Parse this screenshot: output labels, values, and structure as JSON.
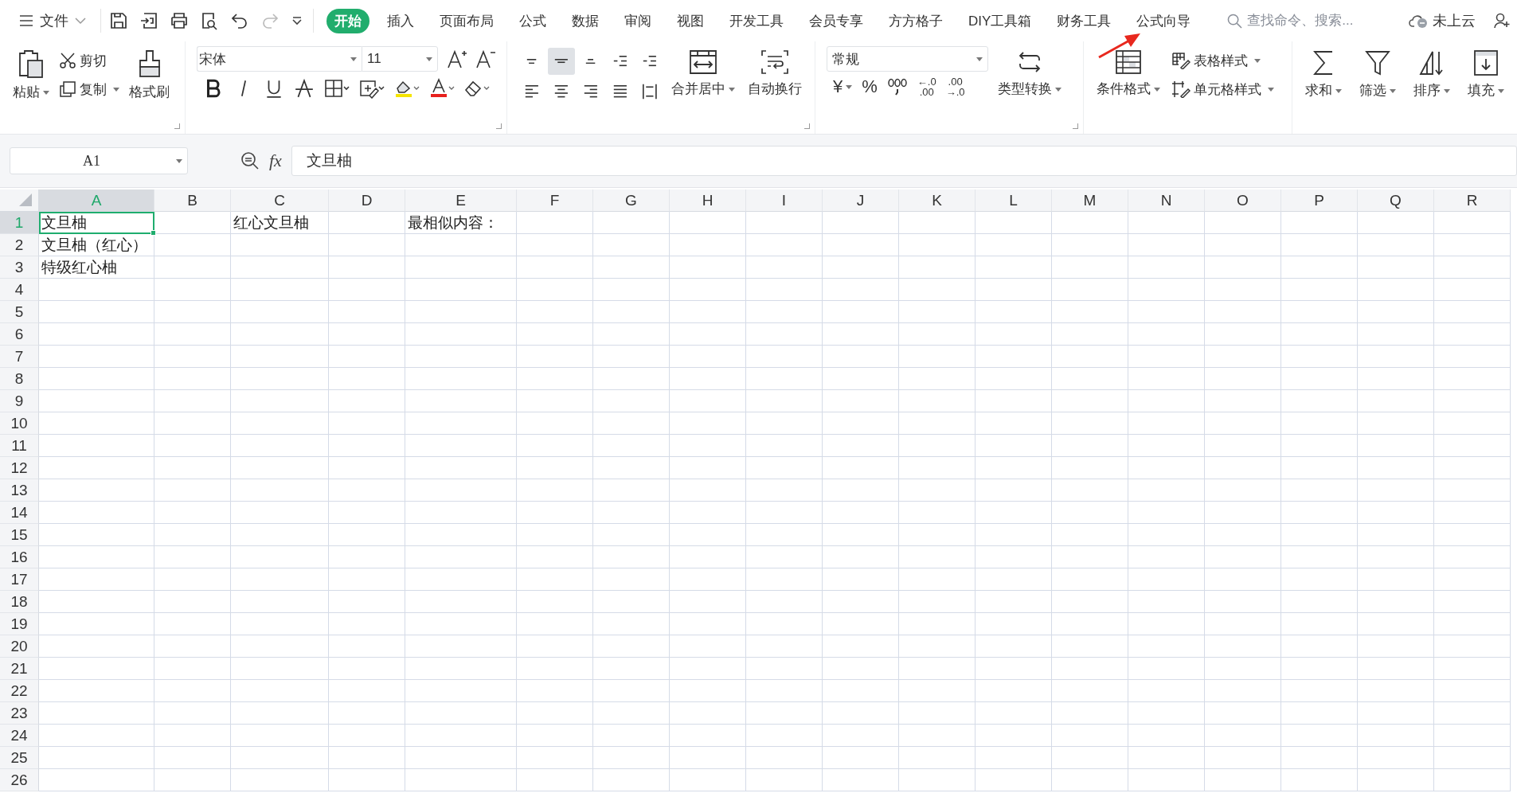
{
  "menu": {
    "file": "文件",
    "tabs": [
      {
        "label": "开始",
        "selected": true
      },
      {
        "label": "插入",
        "selected": false
      },
      {
        "label": "页面布局",
        "selected": false
      },
      {
        "label": "公式",
        "selected": false
      },
      {
        "label": "数据",
        "selected": false
      },
      {
        "label": "审阅",
        "selected": false
      },
      {
        "label": "视图",
        "selected": false
      },
      {
        "label": "开发工具",
        "selected": false
      },
      {
        "label": "会员专享",
        "selected": false
      },
      {
        "label": "方方格子",
        "selected": false
      },
      {
        "label": "DIY工具箱",
        "selected": false
      },
      {
        "label": "财务工具",
        "selected": false
      },
      {
        "label": "公式向导",
        "selected": false
      }
    ]
  },
  "search": {
    "placeholder": "查找命令、搜索..."
  },
  "cloud": {
    "label": "未上云"
  },
  "ribbon": {
    "clipboard": {
      "paste": "粘贴",
      "cut": "剪切",
      "copy": "复制",
      "format_painter": "格式刷"
    },
    "font": {
      "name": "宋体",
      "size": "11"
    },
    "alignment": {
      "buttons": [
        {
          "selected": false
        },
        {
          "selected": true
        },
        {
          "selected": false
        },
        {
          "selected": false
        },
        {
          "selected": false
        },
        {
          "selected": false
        },
        {
          "selected": false
        },
        {
          "selected": false
        },
        {
          "selected": false
        },
        {
          "selected": false
        }
      ],
      "merge": "合并居中",
      "wrap": "自动换行"
    },
    "number": {
      "format": "常规",
      "currency": "¥",
      "percent": "%",
      "decimals": [
        {
          "lines": [
            "←.0",
            ".00"
          ]
        },
        {
          "lines": [
            ".00",
            "→.0"
          ]
        }
      ],
      "convert": "类型转换"
    },
    "styles": {
      "conditional": "条件格式",
      "table_style": "表格样式",
      "cell_style": "单元格样式"
    },
    "editing": [
      {
        "label": "求和"
      },
      {
        "label": "筛选"
      },
      {
        "label": "排序"
      },
      {
        "label": "填充"
      }
    ]
  },
  "formula_bar": {
    "cell": "A1",
    "fx": "fx",
    "value": "文旦柚"
  },
  "sheet": {
    "columns": [
      {
        "label": "A",
        "selected": true
      },
      {
        "label": "B",
        "selected": false
      },
      {
        "label": "C",
        "selected": false
      },
      {
        "label": "D",
        "selected": false
      },
      {
        "label": "E",
        "selected": false
      },
      {
        "label": "F",
        "selected": false
      },
      {
        "label": "G",
        "selected": false
      },
      {
        "label": "H",
        "selected": false
      },
      {
        "label": "I",
        "selected": false
      },
      {
        "label": "J",
        "selected": false
      },
      {
        "label": "K",
        "selected": false
      },
      {
        "label": "L",
        "selected": false
      },
      {
        "label": "M",
        "selected": false
      },
      {
        "label": "N",
        "selected": false
      },
      {
        "label": "O",
        "selected": false
      },
      {
        "label": "P",
        "selected": false
      },
      {
        "label": "Q",
        "selected": false
      },
      {
        "label": "R",
        "selected": false
      }
    ],
    "rows": [
      {
        "header": "1",
        "selected": true,
        "cells": [
          {
            "text": "文旦柚",
            "selected": true
          },
          {
            "selected": false
          },
          {
            "text": "红心文旦柚",
            "selected": false
          },
          {
            "selected": false
          },
          {
            "text": "最相似内容：",
            "selected": false
          }
        ]
      },
      {
        "header": "2",
        "selected": false,
        "cells": [
          {
            "text": "文旦柚（红心）",
            "selected": false
          }
        ]
      },
      {
        "header": "3",
        "selected": false,
        "cells": [
          {
            "text": "特级红心柚",
            "selected": false
          }
        ]
      },
      {
        "header": "4",
        "selected": false
      },
      {
        "header": "5",
        "selected": false
      },
      {
        "header": "6",
        "selected": false
      },
      {
        "header": "7",
        "selected": false
      },
      {
        "header": "8",
        "selected": false
      },
      {
        "header": "9",
        "selected": false
      },
      {
        "header": "10",
        "selected": false
      },
      {
        "header": "11",
        "selected": false
      },
      {
        "header": "12",
        "selected": false
      },
      {
        "header": "13",
        "selected": false
      },
      {
        "header": "14",
        "selected": false
      },
      {
        "header": "15",
        "selected": false
      },
      {
        "header": "16",
        "selected": false
      },
      {
        "header": "17",
        "selected": false
      },
      {
        "header": "18",
        "selected": false
      },
      {
        "header": "19",
        "selected": false
      },
      {
        "header": "20",
        "selected": false
      },
      {
        "header": "21",
        "selected": false
      },
      {
        "header": "22",
        "selected": false
      },
      {
        "header": "23",
        "selected": false
      },
      {
        "header": "24",
        "selected": false
      },
      {
        "header": "25",
        "selected": false
      },
      {
        "header": "26",
        "selected": false
      }
    ]
  }
}
